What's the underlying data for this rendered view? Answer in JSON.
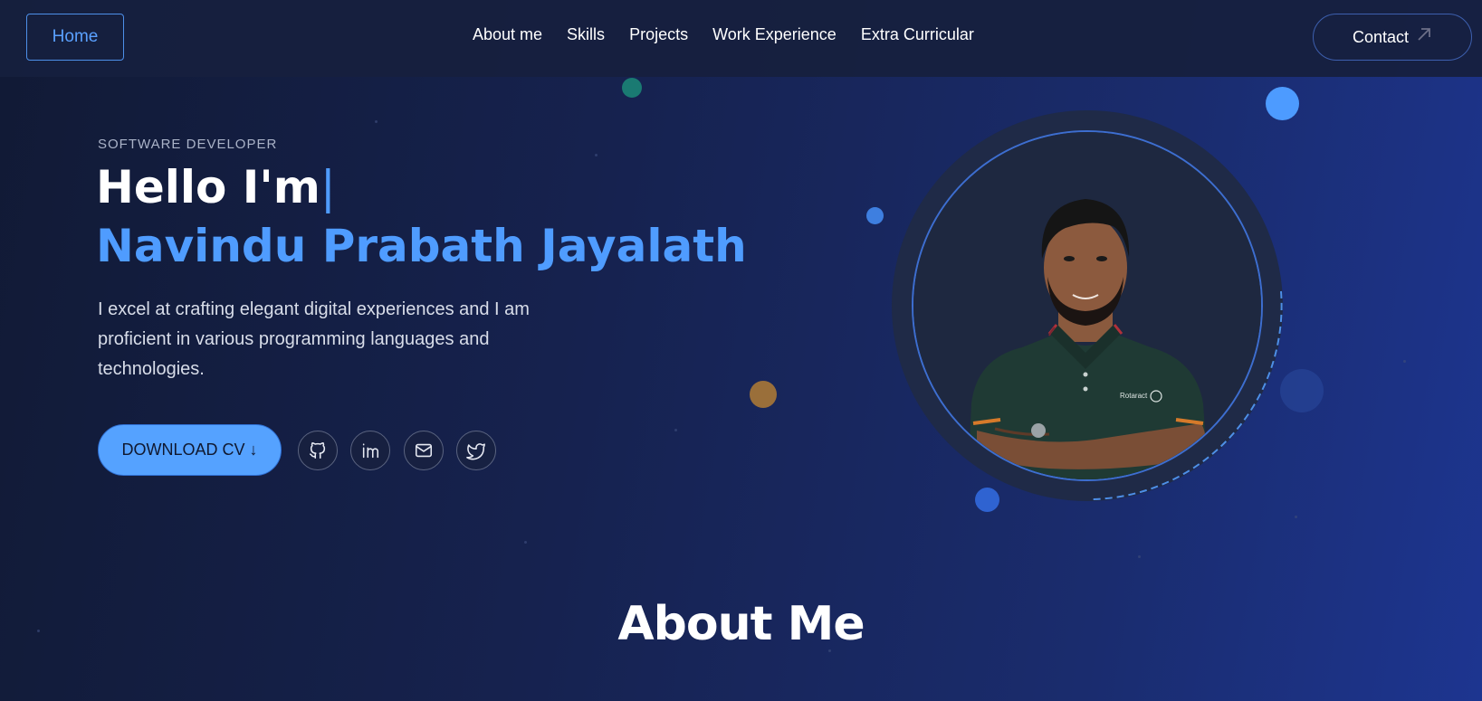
{
  "nav": {
    "home_label": "Home",
    "links": [
      "About me",
      "Skills",
      "Projects",
      "Work Experience",
      "Extra Curricular"
    ],
    "contact_label": "Contact",
    "contact_icon": "arrow-up-right-icon"
  },
  "hero": {
    "eyebrow": "SOFTWARE DEVELOPER",
    "greeting": "Hello I'm",
    "cursor": "|",
    "name": "Navindu Prabath Jayalath",
    "description": "I excel at crafting elegant digital experiences and I am proficient in various programming languages and technologies.",
    "cv_button": "DOWNLOAD CV ↓",
    "socials": [
      "github-icon",
      "linkedin-icon",
      "mail-icon",
      "twitter-icon"
    ],
    "portrait_badge": "Rotaract"
  },
  "about": {
    "title": "About Me"
  },
  "colors": {
    "accent": "#4f9cff",
    "button": "#55a2ff",
    "nav_bg": "#16203e",
    "portrait_ring": "#1f2a47"
  }
}
